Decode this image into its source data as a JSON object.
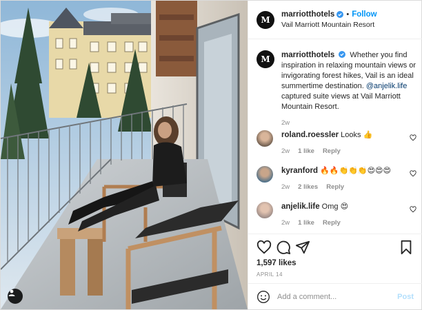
{
  "post": {
    "account": "marriotthotels",
    "follow_label": "Follow",
    "separator": "•",
    "location": "Vail Marriott Mountain Resort",
    "avatar_glyph": "M",
    "caption": {
      "text_before_mention": "Whether you find inspiration in relaxing mountain views or invigorating forest hikes, Vail is an ideal summertime destination.",
      "mention": "@anjelik.life",
      "text_after_mention": "captured suite views at Vail Marriott Mountain Resort.",
      "time": "2w"
    },
    "comments": [
      {
        "user": "roland.roessler",
        "text": "Looks 👍",
        "time": "2w",
        "likes": "1 like",
        "reply": "Reply"
      },
      {
        "user": "kyranford",
        "text": "🔥🔥👏👏👏😍😍😍",
        "time": "2w",
        "likes": "2 likes",
        "reply": "Reply"
      },
      {
        "user": "anjelik.life",
        "text": "Omg 😍",
        "time": "2w",
        "likes": "1 like",
        "reply": "Reply"
      }
    ],
    "likes_count": "1,597 likes",
    "date": "APRIL 14",
    "add_comment_placeholder": "Add a comment...",
    "post_label": "Post"
  },
  "colors": {
    "link_blue": "#0095f6",
    "mention_blue": "#00376b",
    "muted": "#8e8e8e",
    "post_disabled": "#b2dffc",
    "verified": "#3897f0"
  },
  "icons": [
    "person-tag-icon",
    "verified-badge-icon",
    "heart-icon",
    "comment-icon",
    "share-icon",
    "save-icon",
    "emoji-icon"
  ]
}
